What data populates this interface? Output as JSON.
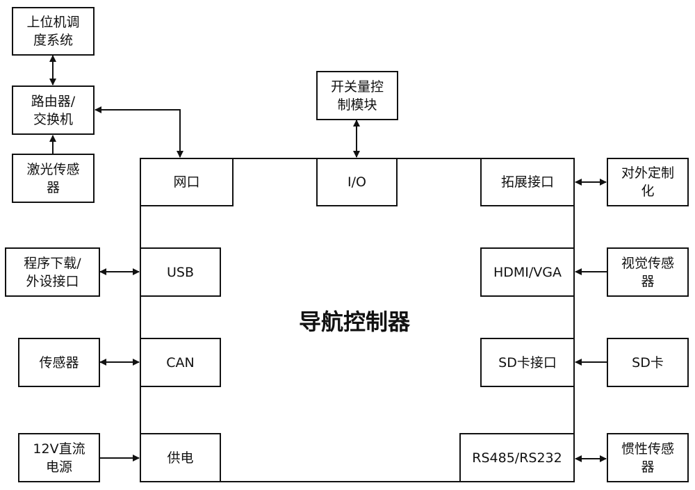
{
  "main": {
    "title": "导航控制器"
  },
  "ports": {
    "net": "网口",
    "io": "I/O",
    "ext": "拓展接口",
    "usb": "USB",
    "can": "CAN",
    "power": "供电",
    "hdmi": "HDMI/VGA",
    "sd": "SD卡接口",
    "rs": "RS485/RS232"
  },
  "external": {
    "host": [
      "上位机调",
      "度系统"
    ],
    "router": [
      "路由器/",
      "交换机"
    ],
    "lidar": [
      "激光传感",
      "器"
    ],
    "download": [
      "程序下载/",
      "外设接口"
    ],
    "sensor": [
      "传感器"
    ],
    "dc": [
      "12V直流",
      "电源"
    ],
    "switch": [
      "开关量控",
      "制模块"
    ],
    "custom": [
      "对外定制",
      "化"
    ],
    "vision": [
      "视觉传感",
      "器"
    ],
    "sdcard": [
      "SD卡"
    ],
    "imu": [
      "惯性传感",
      "器"
    ]
  }
}
